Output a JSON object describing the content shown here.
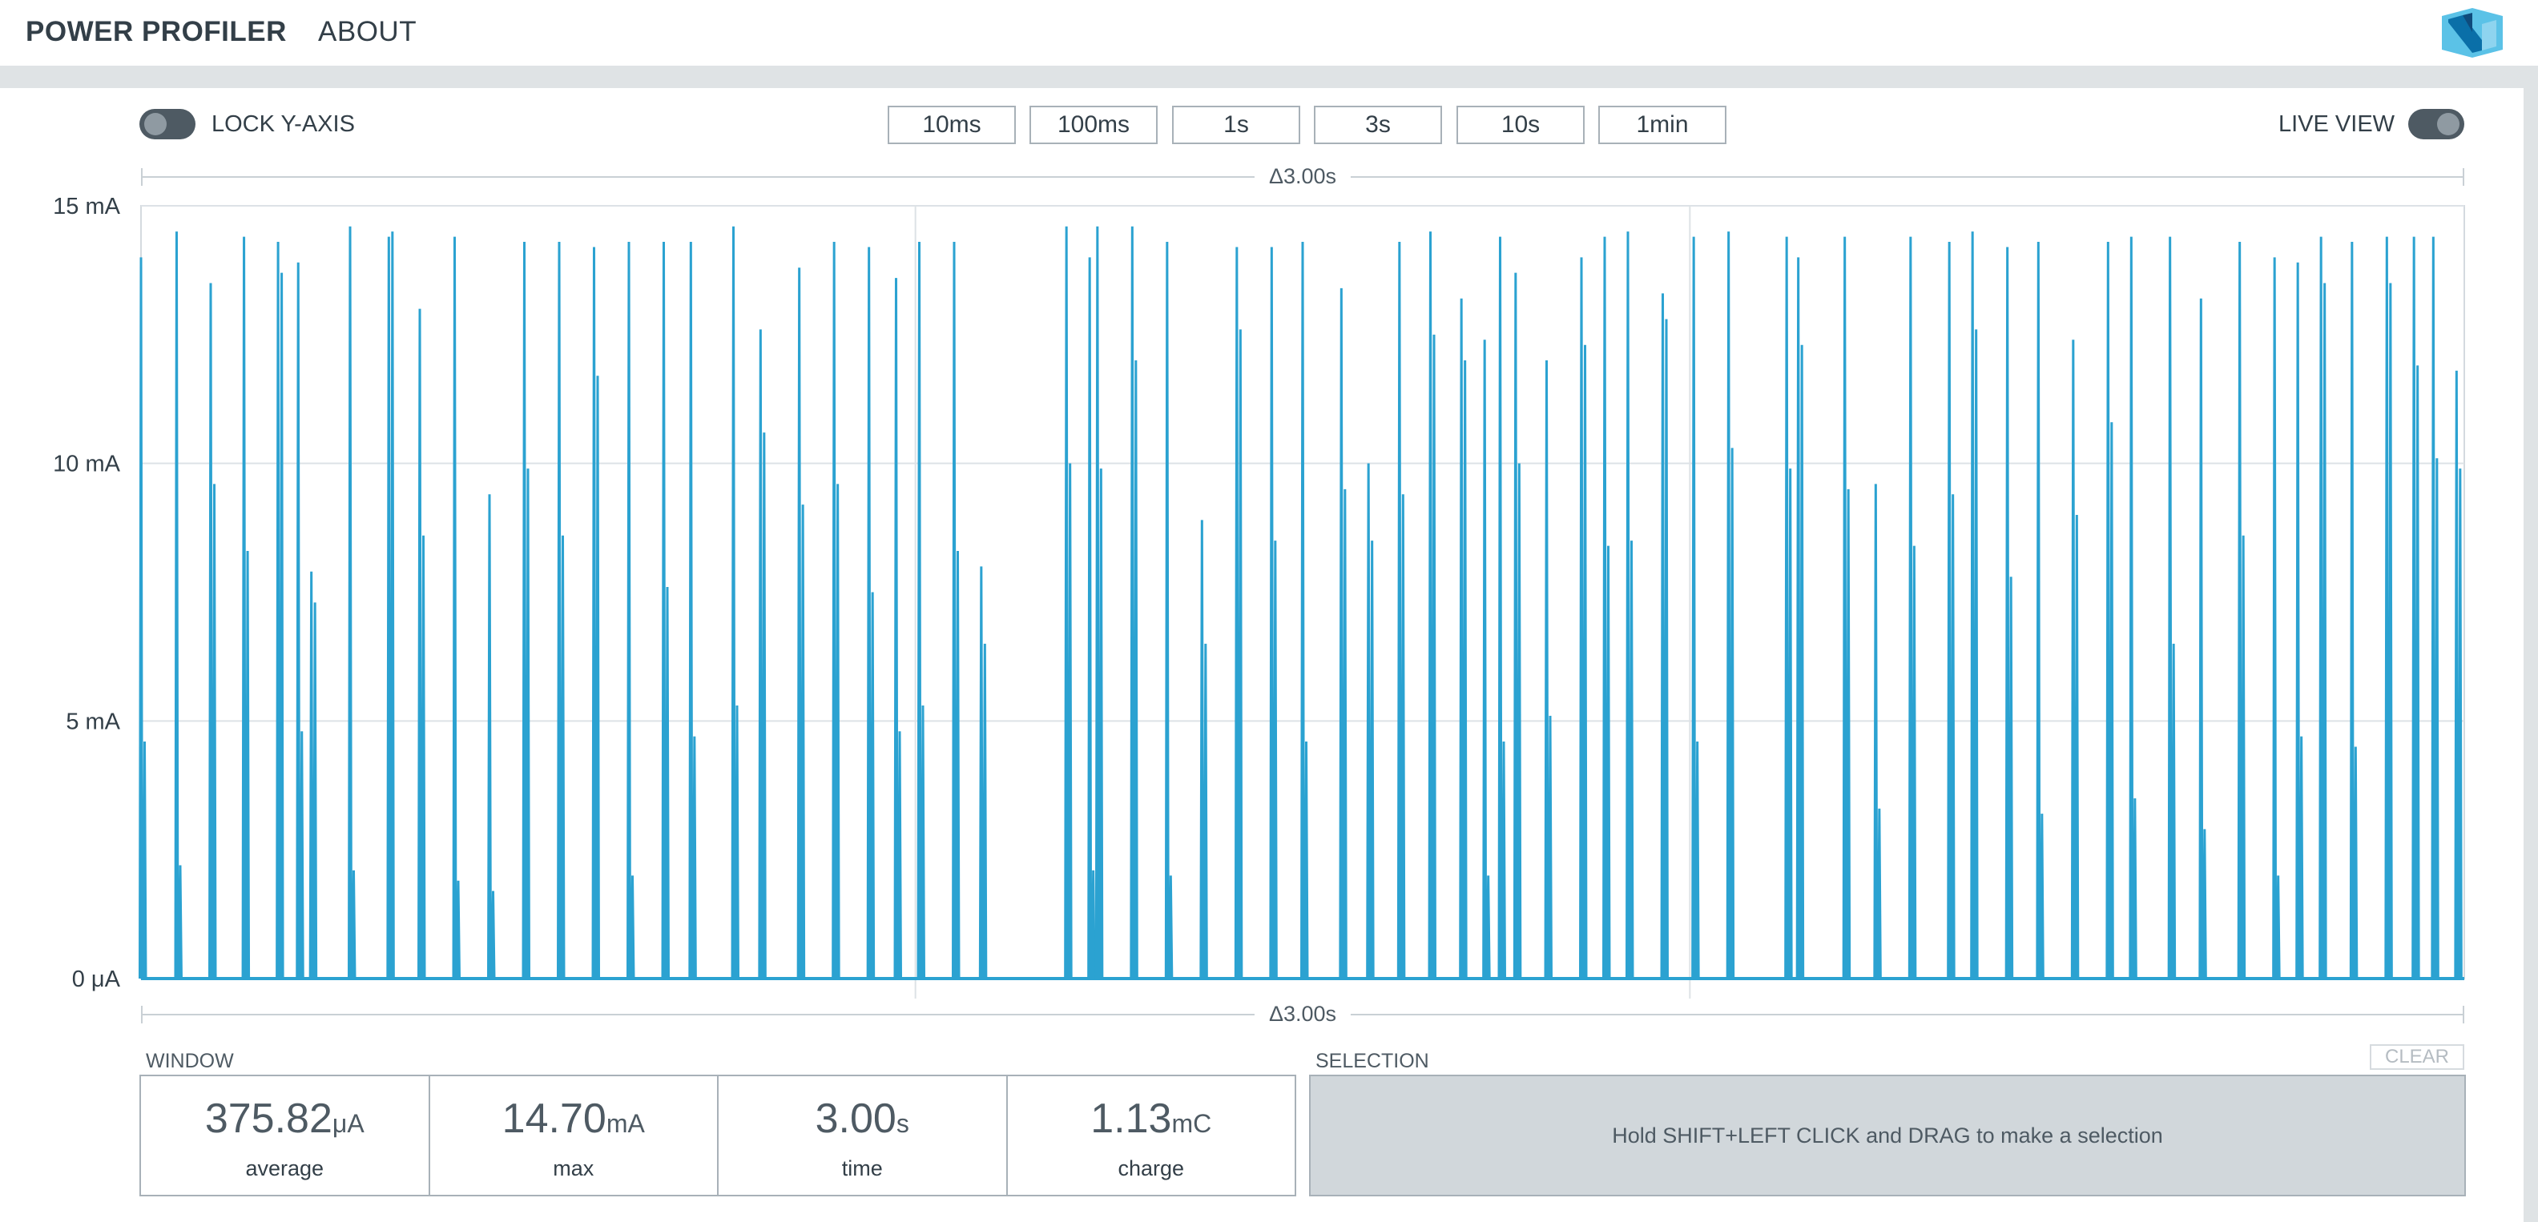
{
  "nav": {
    "power_profiler": "POWER PROFILER",
    "about": "ABOUT",
    "logo_icon": "nordic-logo-icon"
  },
  "controls": {
    "lock_y_axis_label": "LOCK Y-AXIS",
    "live_view_label": "LIVE VIEW",
    "zoom_buttons": [
      "10ms",
      "100ms",
      "1s",
      "3s",
      "10s",
      "1min"
    ]
  },
  "chart": {
    "delta_top": "Δ3.00s",
    "delta_bottom": "Δ3.00s",
    "y_ticks": [
      "15 mA",
      "10 mA",
      "5 mA",
      "0 μA"
    ]
  },
  "chart_data": {
    "type": "line",
    "xlabel": "",
    "ylabel": "",
    "x_unit": "s",
    "y_unit": "mA",
    "xlim": [
      0,
      3.0
    ],
    "ylim": [
      0,
      15
    ],
    "y_tick_values": [
      15,
      10,
      5,
      0
    ],
    "grid": true,
    "line_color": "#2ba2d1",
    "baseline": 0,
    "series": [
      {
        "spikes": [
          {
            "t": 0.0,
            "peak": 14.0,
            "sub": 4.6
          },
          {
            "t": 0.046,
            "peak": 14.5,
            "sub": 2.2
          },
          {
            "t": 0.09,
            "peak": 13.5,
            "sub": 9.6
          },
          {
            "t": 0.133,
            "peak": 14.4,
            "sub": 8.3
          },
          {
            "t": 0.177,
            "peak": 14.3,
            "sub": 13.7
          },
          {
            "t": 0.203,
            "peak": 13.9,
            "sub": 4.8
          },
          {
            "t": 0.22,
            "peak": 7.9,
            "sub": 7.3
          },
          {
            "t": 0.27,
            "peak": 14.6,
            "sub": 2.1
          },
          {
            "t": 0.32,
            "peak": 14.4,
            "sub": 14.5
          },
          {
            "t": 0.36,
            "peak": 13.0,
            "sub": 8.6
          },
          {
            "t": 0.405,
            "peak": 14.4,
            "sub": 1.9
          },
          {
            "t": 0.45,
            "peak": 9.4,
            "sub": 1.7
          },
          {
            "t": 0.495,
            "peak": 14.3,
            "sub": 9.9
          },
          {
            "t": 0.54,
            "peak": 14.3,
            "sub": 8.6
          },
          {
            "t": 0.585,
            "peak": 14.2,
            "sub": 11.7
          },
          {
            "t": 0.63,
            "peak": 14.3,
            "sub": 2.0
          },
          {
            "t": 0.675,
            "peak": 14.3,
            "sub": 7.6
          },
          {
            "t": 0.71,
            "peak": 14.3,
            "sub": 4.7
          },
          {
            "t": 0.765,
            "peak": 14.6,
            "sub": 5.3
          },
          {
            "t": 0.8,
            "peak": 12.6,
            "sub": 10.6
          },
          {
            "t": 0.85,
            "peak": 13.8,
            "sub": 9.2
          },
          {
            "t": 0.895,
            "peak": 14.3,
            "sub": 9.6
          },
          {
            "t": 0.94,
            "peak": 14.2,
            "sub": 7.5
          },
          {
            "t": 0.975,
            "peak": 13.6,
            "sub": 4.8
          },
          {
            "t": 1.005,
            "peak": 14.3,
            "sub": 5.3
          },
          {
            "t": 1.05,
            "peak": 14.3,
            "sub": 8.3
          },
          {
            "t": 1.085,
            "peak": 8.0,
            "sub": 6.5
          },
          {
            "t": 1.195,
            "peak": 14.6,
            "sub": 10.0
          },
          {
            "t": 1.225,
            "peak": 14.0,
            "sub": 2.1
          },
          {
            "t": 1.235,
            "peak": 14.6,
            "sub": 9.9
          },
          {
            "t": 1.28,
            "peak": 14.6,
            "sub": 12.0
          },
          {
            "t": 1.325,
            "peak": 14.3,
            "sub": 2.0
          },
          {
            "t": 1.37,
            "peak": 8.9,
            "sub": 6.5
          },
          {
            "t": 1.415,
            "peak": 14.2,
            "sub": 12.6
          },
          {
            "t": 1.46,
            "peak": 14.2,
            "sub": 8.5
          },
          {
            "t": 1.5,
            "peak": 14.3,
            "sub": 4.6
          },
          {
            "t": 1.55,
            "peak": 13.4,
            "sub": 9.5
          },
          {
            "t": 1.585,
            "peak": 10.0,
            "sub": 8.5
          },
          {
            "t": 1.625,
            "peak": 14.3,
            "sub": 9.4
          },
          {
            "t": 1.665,
            "peak": 14.5,
            "sub": 12.5
          },
          {
            "t": 1.705,
            "peak": 13.2,
            "sub": 12.0
          },
          {
            "t": 1.735,
            "peak": 12.4,
            "sub": 2.0
          },
          {
            "t": 1.755,
            "peak": 14.4,
            "sub": 4.6
          },
          {
            "t": 1.775,
            "peak": 13.7,
            "sub": 10.0
          },
          {
            "t": 1.815,
            "peak": 12.0,
            "sub": 5.1
          },
          {
            "t": 1.86,
            "peak": 14.0,
            "sub": 12.3
          },
          {
            "t": 1.89,
            "peak": 14.4,
            "sub": 8.4
          },
          {
            "t": 1.92,
            "peak": 14.5,
            "sub": 8.5
          },
          {
            "t": 1.965,
            "peak": 13.3,
            "sub": 12.8
          },
          {
            "t": 2.005,
            "peak": 14.4,
            "sub": 4.6
          },
          {
            "t": 2.05,
            "peak": 14.5,
            "sub": 10.3
          },
          {
            "t": 2.125,
            "peak": 14.4,
            "sub": 9.9
          },
          {
            "t": 2.14,
            "peak": 14.0,
            "sub": 12.3
          },
          {
            "t": 2.2,
            "peak": 14.4,
            "sub": 9.5
          },
          {
            "t": 2.24,
            "peak": 9.6,
            "sub": 3.3
          },
          {
            "t": 2.285,
            "peak": 14.4,
            "sub": 8.4
          },
          {
            "t": 2.335,
            "peak": 14.3,
            "sub": 9.4
          },
          {
            "t": 2.365,
            "peak": 14.5,
            "sub": 12.6
          },
          {
            "t": 2.41,
            "peak": 14.2,
            "sub": 7.8
          },
          {
            "t": 2.45,
            "peak": 14.3,
            "sub": 3.2
          },
          {
            "t": 2.495,
            "peak": 12.4,
            "sub": 9.0
          },
          {
            "t": 2.54,
            "peak": 14.3,
            "sub": 10.8
          },
          {
            "t": 2.57,
            "peak": 14.4,
            "sub": 3.5
          },
          {
            "t": 2.62,
            "peak": 14.4,
            "sub": 6.5
          },
          {
            "t": 2.66,
            "peak": 13.2,
            "sub": 2.9
          },
          {
            "t": 2.71,
            "peak": 14.3,
            "sub": 8.6
          },
          {
            "t": 2.755,
            "peak": 14.0,
            "sub": 2.0
          },
          {
            "t": 2.785,
            "peak": 13.9,
            "sub": 4.7
          },
          {
            "t": 2.815,
            "peak": 14.4,
            "sub": 13.5
          },
          {
            "t": 2.855,
            "peak": 14.3,
            "sub": 4.5
          },
          {
            "t": 2.9,
            "peak": 14.4,
            "sub": 13.5
          },
          {
            "t": 2.935,
            "peak": 14.4,
            "sub": 11.9
          },
          {
            "t": 2.96,
            "peak": 14.4,
            "sub": 10.1
          },
          {
            "t": 2.99,
            "peak": 11.8,
            "sub": 9.9
          }
        ]
      }
    ]
  },
  "stats": {
    "window_label": "WINDOW",
    "items": [
      {
        "value": "375.82",
        "unit": "μA",
        "caption": "average"
      },
      {
        "value": "14.70",
        "unit": "mA",
        "caption": "max"
      },
      {
        "value": "3.00",
        "unit": "s",
        "caption": "time"
      },
      {
        "value": "1.13",
        "unit": "mC",
        "caption": "charge"
      }
    ],
    "selection_label": "SELECTION",
    "clear_label": "CLEAR",
    "selection_hint": "Hold SHIFT+LEFT CLICK and DRAG to make a selection"
  }
}
